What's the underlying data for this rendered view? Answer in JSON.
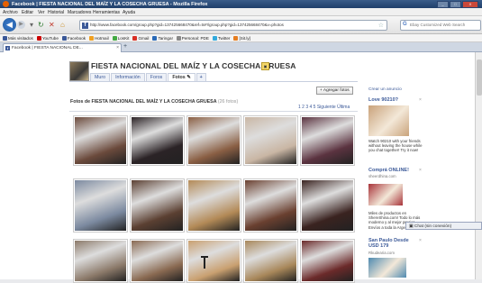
{
  "window": {
    "title": "Facebook | FIESTA NACIONAL DEL MAÍZ Y LA COSECHA GRUESA - Mozilla Firefox",
    "buttons": [
      "_",
      "□",
      "X"
    ]
  },
  "menu": [
    "Archivo",
    "Editar",
    "Ver",
    "Historial",
    "Marcadores",
    "Herramientas",
    "Ayuda"
  ],
  "nav": {
    "back_icon": "back-arrow-icon",
    "url": "http://www.facebook.com/group.php?gid=137425668470&ref=ts#!/group.php?gid=137425668470&v=photos",
    "search_placeholder": "Ebay Customized Web Search"
  },
  "bookmarks": [
    {
      "label": "Más visitados",
      "color": "#3b5998"
    },
    {
      "label": "YouTube",
      "color": "#cc0000"
    },
    {
      "label": "Facebook",
      "color": "#3b5998"
    },
    {
      "label": "Hotmail",
      "color": "#f0a020"
    },
    {
      "label": "LosKit",
      "color": "#44aa44"
    },
    {
      "label": "Gmail",
      "color": "#d93025"
    },
    {
      "label": "Taringa!",
      "color": "#2a6ab8"
    },
    {
      "label": "Personal: PDE",
      "color": "#888888"
    },
    {
      "label": "Twitter",
      "color": "#33aadd"
    },
    {
      "label": "[Sit.ly]",
      "color": "#e67e22"
    }
  ],
  "tab": {
    "label": "Facebook | FIESTA NACIONAL DE...",
    "close": "×",
    "new": "+"
  },
  "group": {
    "title": "FIESTA NACIONAL DEL MAÍZ Y LA COSECHA GRUESA",
    "tabs": [
      "Muro",
      "Información",
      "Foros",
      "Fotos ✎",
      "+"
    ],
    "active_tab": 3,
    "add_photos": "+ Agregar fotos"
  },
  "photos": {
    "heading": "Fotos de FIESTA NACIONAL DEL MAÍZ Y LA COSECHA GRUESA",
    "count": "(26 fotos)",
    "pager": "1 2 3 4 5 Siguiente Última",
    "thumb_colors": [
      [
        "#6b4a3c",
        "#2b2326",
        "#8a5f44",
        "#c9b6a4",
        "#5b3340"
      ],
      [
        "#7c8aa0",
        "#5b4032",
        "#b38a57",
        "#6a4030",
        "#3a2320"
      ],
      [
        "#8c7a6a",
        "#8a6a52",
        "#c9a070",
        "#a8875a",
        "#6b2a2a"
      ]
    ]
  },
  "sidebar": {
    "create_ad": "Crear un anuncio",
    "ads": [
      {
        "title": "Love 90210?",
        "body": "Watch 90210 with your friends without leaving the house while you chat together! Try it now!",
        "color": "#c9a27a"
      },
      {
        "title": "Comprá ONLINE!",
        "sub": "sheerdhina.com",
        "body": "Miles de productos en ShereShina.com! Todo lo más moderno y al mejor precio! Envíos a toda la Argentina",
        "color": "#a8343a"
      },
      {
        "title": "San Paulo Desde USD 179",
        "sub": "Rkudearia.com",
        "body": "",
        "color": "#4f8ab0"
      }
    ],
    "close_icon": "×"
  },
  "chat": {
    "label": "Chat (sin conexión)"
  }
}
